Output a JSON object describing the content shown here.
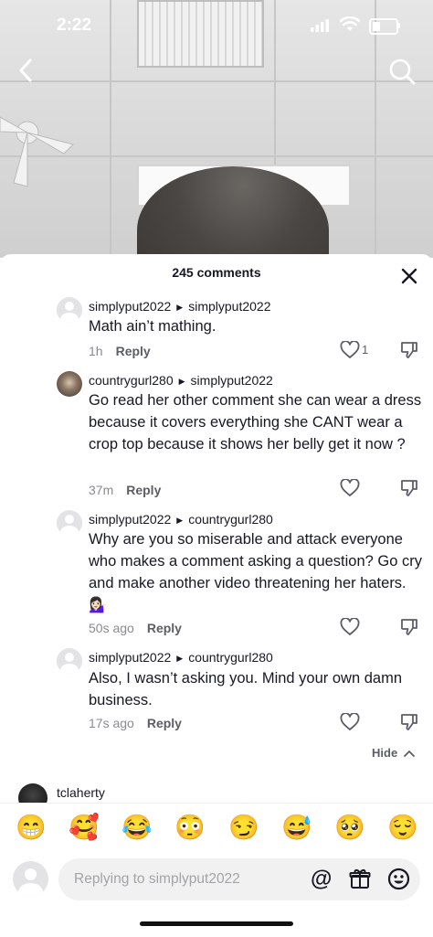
{
  "status_bar": {
    "time": "2:22"
  },
  "sheet": {
    "title": "245 comments",
    "hide_label": "Hide"
  },
  "comments": [
    {
      "author": "simplyput2022",
      "reply_to": "simplyput2022",
      "text": "Math ain’t mathing.",
      "time": "1h",
      "reply_label": "Reply",
      "likes": "1"
    },
    {
      "author": "countrygurl280",
      "reply_to": "simplyput2022",
      "text": "Go read her other comment she can wear a dress because it covers everything she CANT wear a crop top because it shows her belly get it now ?",
      "time": "37m",
      "reply_label": "Reply",
      "likes": ""
    },
    {
      "author": "simplyput2022",
      "reply_to": "countrygurl280",
      "text": "Why are you so miserable and attack everyone who makes a comment asking a question? Go cry and make another video threatening her haters. 💁🏻‍♀️",
      "time": "50s ago",
      "reply_label": "Reply",
      "likes": ""
    },
    {
      "author": "simplyput2022",
      "reply_to": "countrygurl280",
      "text": "Also, I wasn’t asking you. Mind your own damn business.",
      "time": "17s ago",
      "reply_label": "Reply",
      "likes": ""
    }
  ],
  "next_comment": {
    "author": "tclaherty"
  },
  "emoji_bar": [
    "😁",
    "🥰",
    "😂",
    "😳",
    "😏",
    "😅",
    "🥺",
    "😌"
  ],
  "input": {
    "placeholder": "Replying to simplyput2022",
    "at_label": "@"
  }
}
